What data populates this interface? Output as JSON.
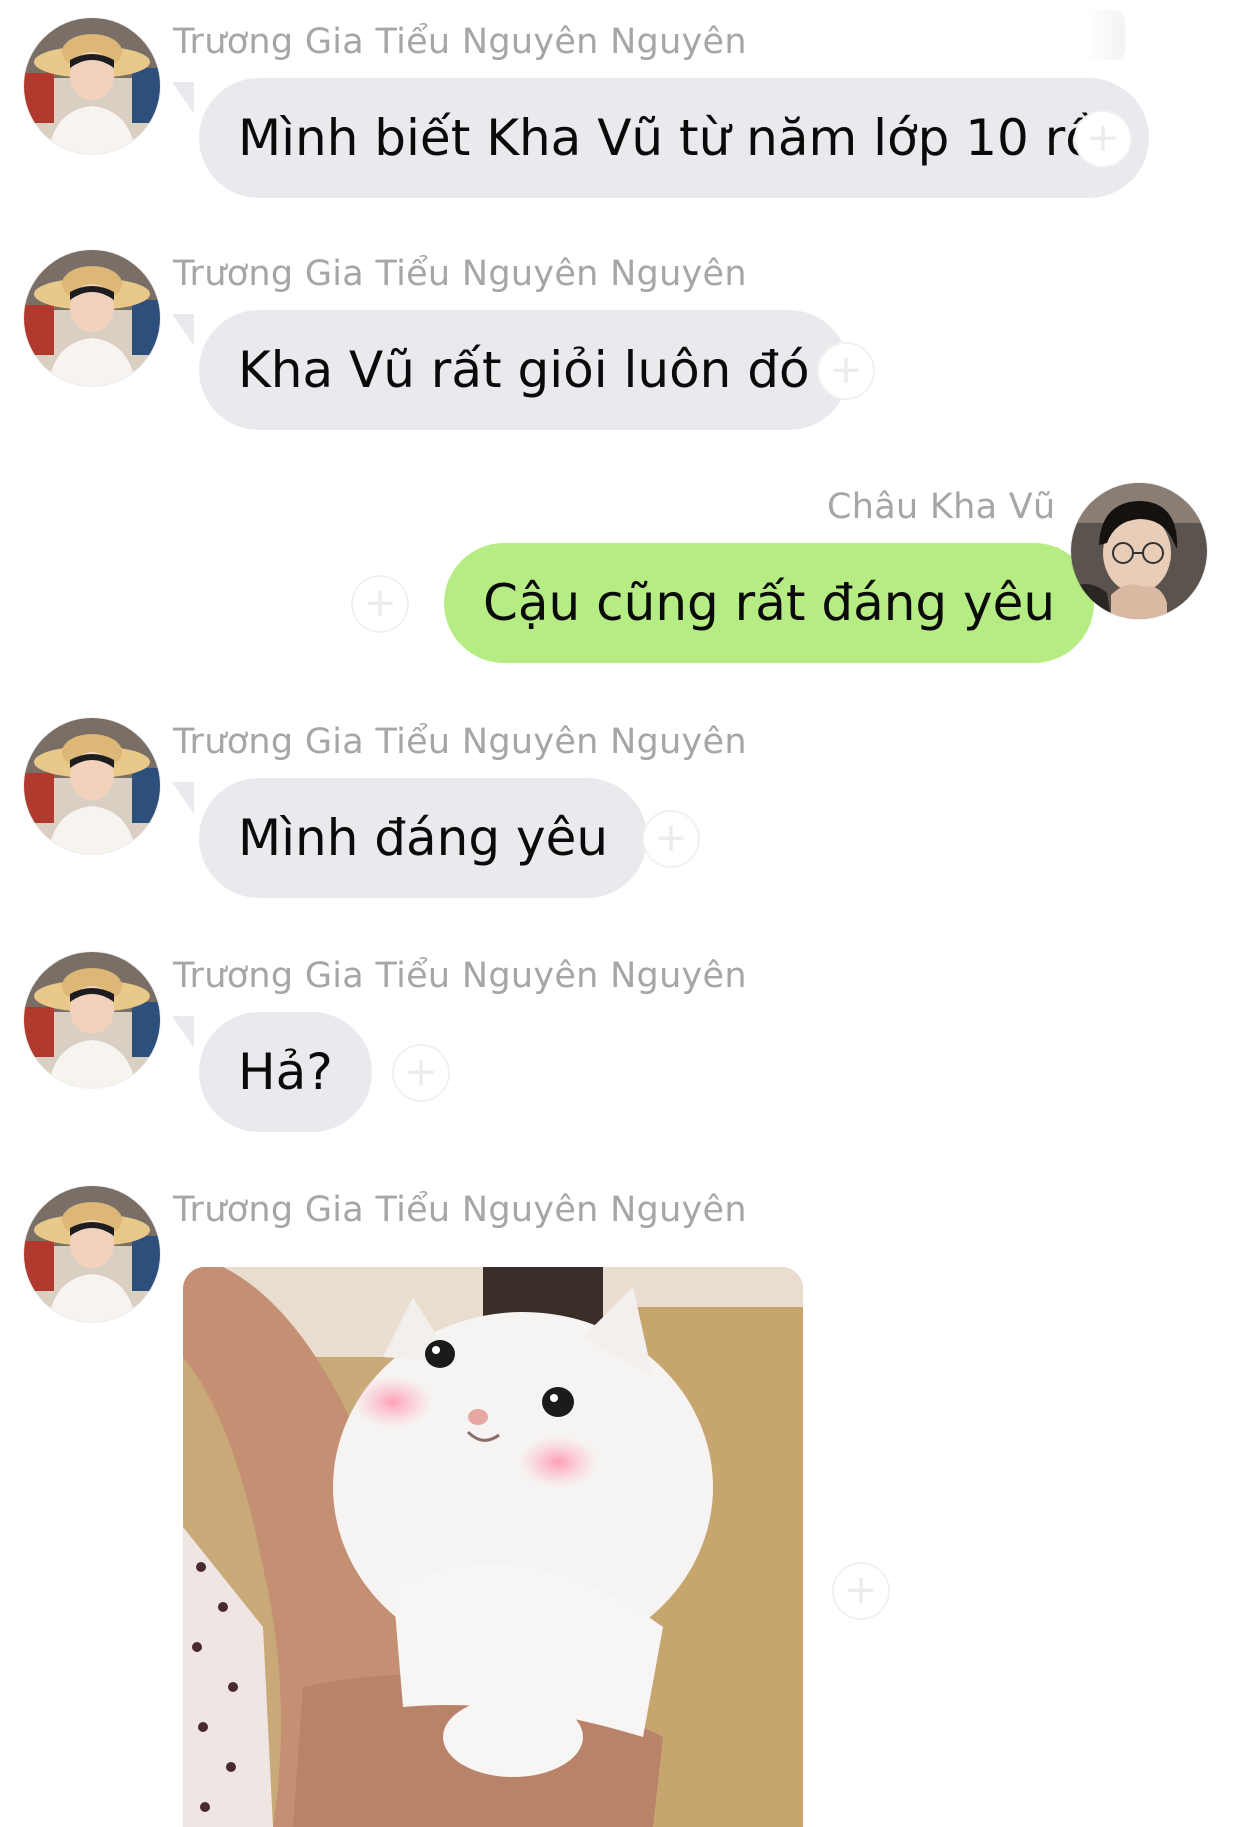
{
  "messages": [
    {
      "sender": "Trương Gia Tiểu Nguyên Nguyên",
      "text": "Mình biết Kha Vũ từ năm lớp 10 rồi",
      "direction": "incoming"
    },
    {
      "sender": "Trương Gia Tiểu Nguyên Nguyên",
      "text": "Kha Vũ rất giỏi luôn đó",
      "direction": "incoming"
    },
    {
      "sender": "Châu Kha Vũ",
      "text": "Cậu cũng rất đáng yêu",
      "direction": "outgoing"
    },
    {
      "sender": "Trương Gia Tiểu Nguyên Nguyên",
      "text": "Mình đáng yêu",
      "direction": "incoming"
    },
    {
      "sender": "Trương Gia Tiểu Nguyên Nguyên",
      "text": "Hả?",
      "direction": "incoming"
    },
    {
      "sender": "Trương Gia Tiểu Nguyên Nguyên",
      "text": "",
      "direction": "incoming",
      "image": "blushing-white-cat-sticker"
    }
  ],
  "icons": {
    "react": "+",
    "react_name": "add-reaction-icon"
  },
  "colors": {
    "incoming_bubble": "#e9eaed",
    "outgoing_bubble": "#b5ec83",
    "sender_name": "#a6a6a6",
    "background": "#ffffff"
  }
}
